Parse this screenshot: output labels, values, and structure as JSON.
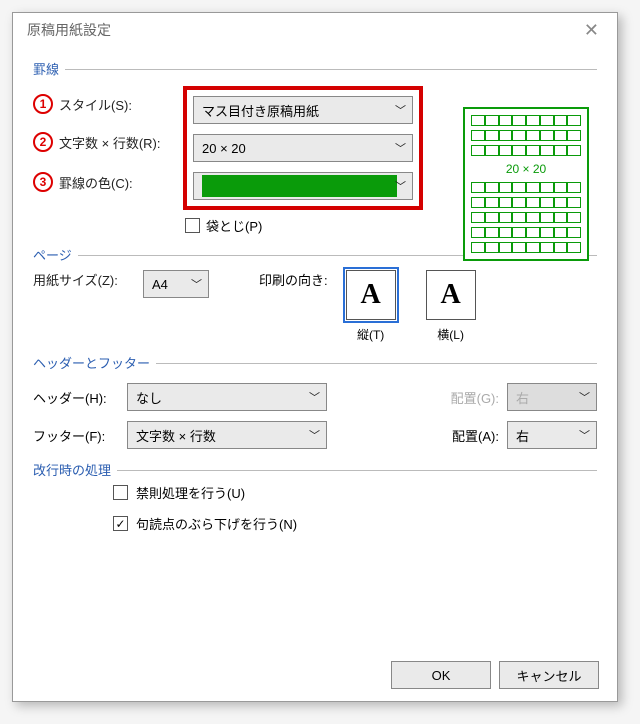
{
  "window": {
    "title": "原稿用紙設定"
  },
  "groups": {
    "grid": "罫線",
    "page": "ページ",
    "hf": "ヘッダーとフッター",
    "linebreak": "改行時の処理"
  },
  "annotations": [
    "1",
    "2",
    "3"
  ],
  "grid": {
    "style_label": "スタイル(S):",
    "style_value": "マス目付き原稿用紙",
    "size_label": "文字数 × 行数(R):",
    "size_value": "20 × 20",
    "color_label": "罫線の色(C):",
    "color_value": "#0a9b0a",
    "fold_label": "袋とじ(P)"
  },
  "preview": {
    "text": "20 × 20"
  },
  "page": {
    "paper_label": "用紙サイズ(Z):",
    "paper_value": "A4",
    "orient_label": "印刷の向き:",
    "orient_portrait": "縦(T)",
    "orient_landscape": "横(L)",
    "glyph": "A"
  },
  "hf": {
    "header_label": "ヘッダー(H):",
    "header_value": "なし",
    "header_align_label": "配置(G):",
    "header_align_value": "右",
    "footer_label": "フッター(F):",
    "footer_value": "文字数 × 行数",
    "footer_align_label": "配置(A):",
    "footer_align_value": "右"
  },
  "linebreak": {
    "kinsoku": "禁則処理を行う(U)",
    "hanging": "句読点のぶら下げを行う(N)"
  },
  "buttons": {
    "ok": "OK",
    "cancel": "キャンセル"
  }
}
